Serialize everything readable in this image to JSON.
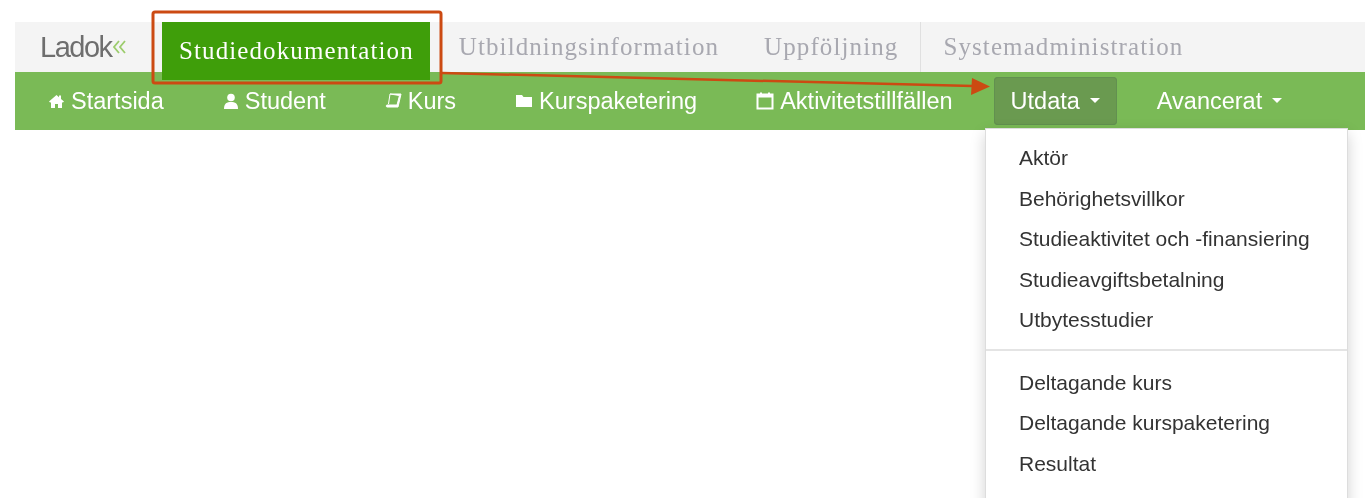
{
  "logo": {
    "text": "Ladok"
  },
  "main_tabs": [
    {
      "label": "Studiedokumentation",
      "selected": true
    },
    {
      "label": "Utbildningsinformation",
      "selected": false
    },
    {
      "label": "Uppföljning",
      "selected": false
    },
    {
      "label": "Systemadministration",
      "selected": false
    }
  ],
  "nav": [
    {
      "label": "Startsida",
      "kind": "link",
      "selected": false
    },
    {
      "label": "Student",
      "kind": "link",
      "selected": false
    },
    {
      "label": "Kurs",
      "kind": "link",
      "selected": false
    },
    {
      "label": "Kurspaketering",
      "kind": "link",
      "selected": false
    },
    {
      "label": "Aktivitetstillfällen",
      "kind": "link",
      "selected": false
    },
    {
      "label": "Utdata",
      "kind": "dropdown",
      "selected": true
    },
    {
      "label": "Avancerat",
      "kind": "dropdown",
      "selected": false
    }
  ],
  "dropdown": {
    "sections": [
      {
        "items": [
          "Aktör",
          "Behörighetsvillkor",
          "Studieaktivitet och -finansiering",
          "Studieavgiftsbetalning",
          "Utbytesstudier"
        ]
      },
      {
        "items": [
          "Deltagande kurs",
          "Deltagande kurspaketering",
          "Resultat"
        ]
      }
    ]
  },
  "annotation": {
    "kind": "frame-with-arrow"
  }
}
